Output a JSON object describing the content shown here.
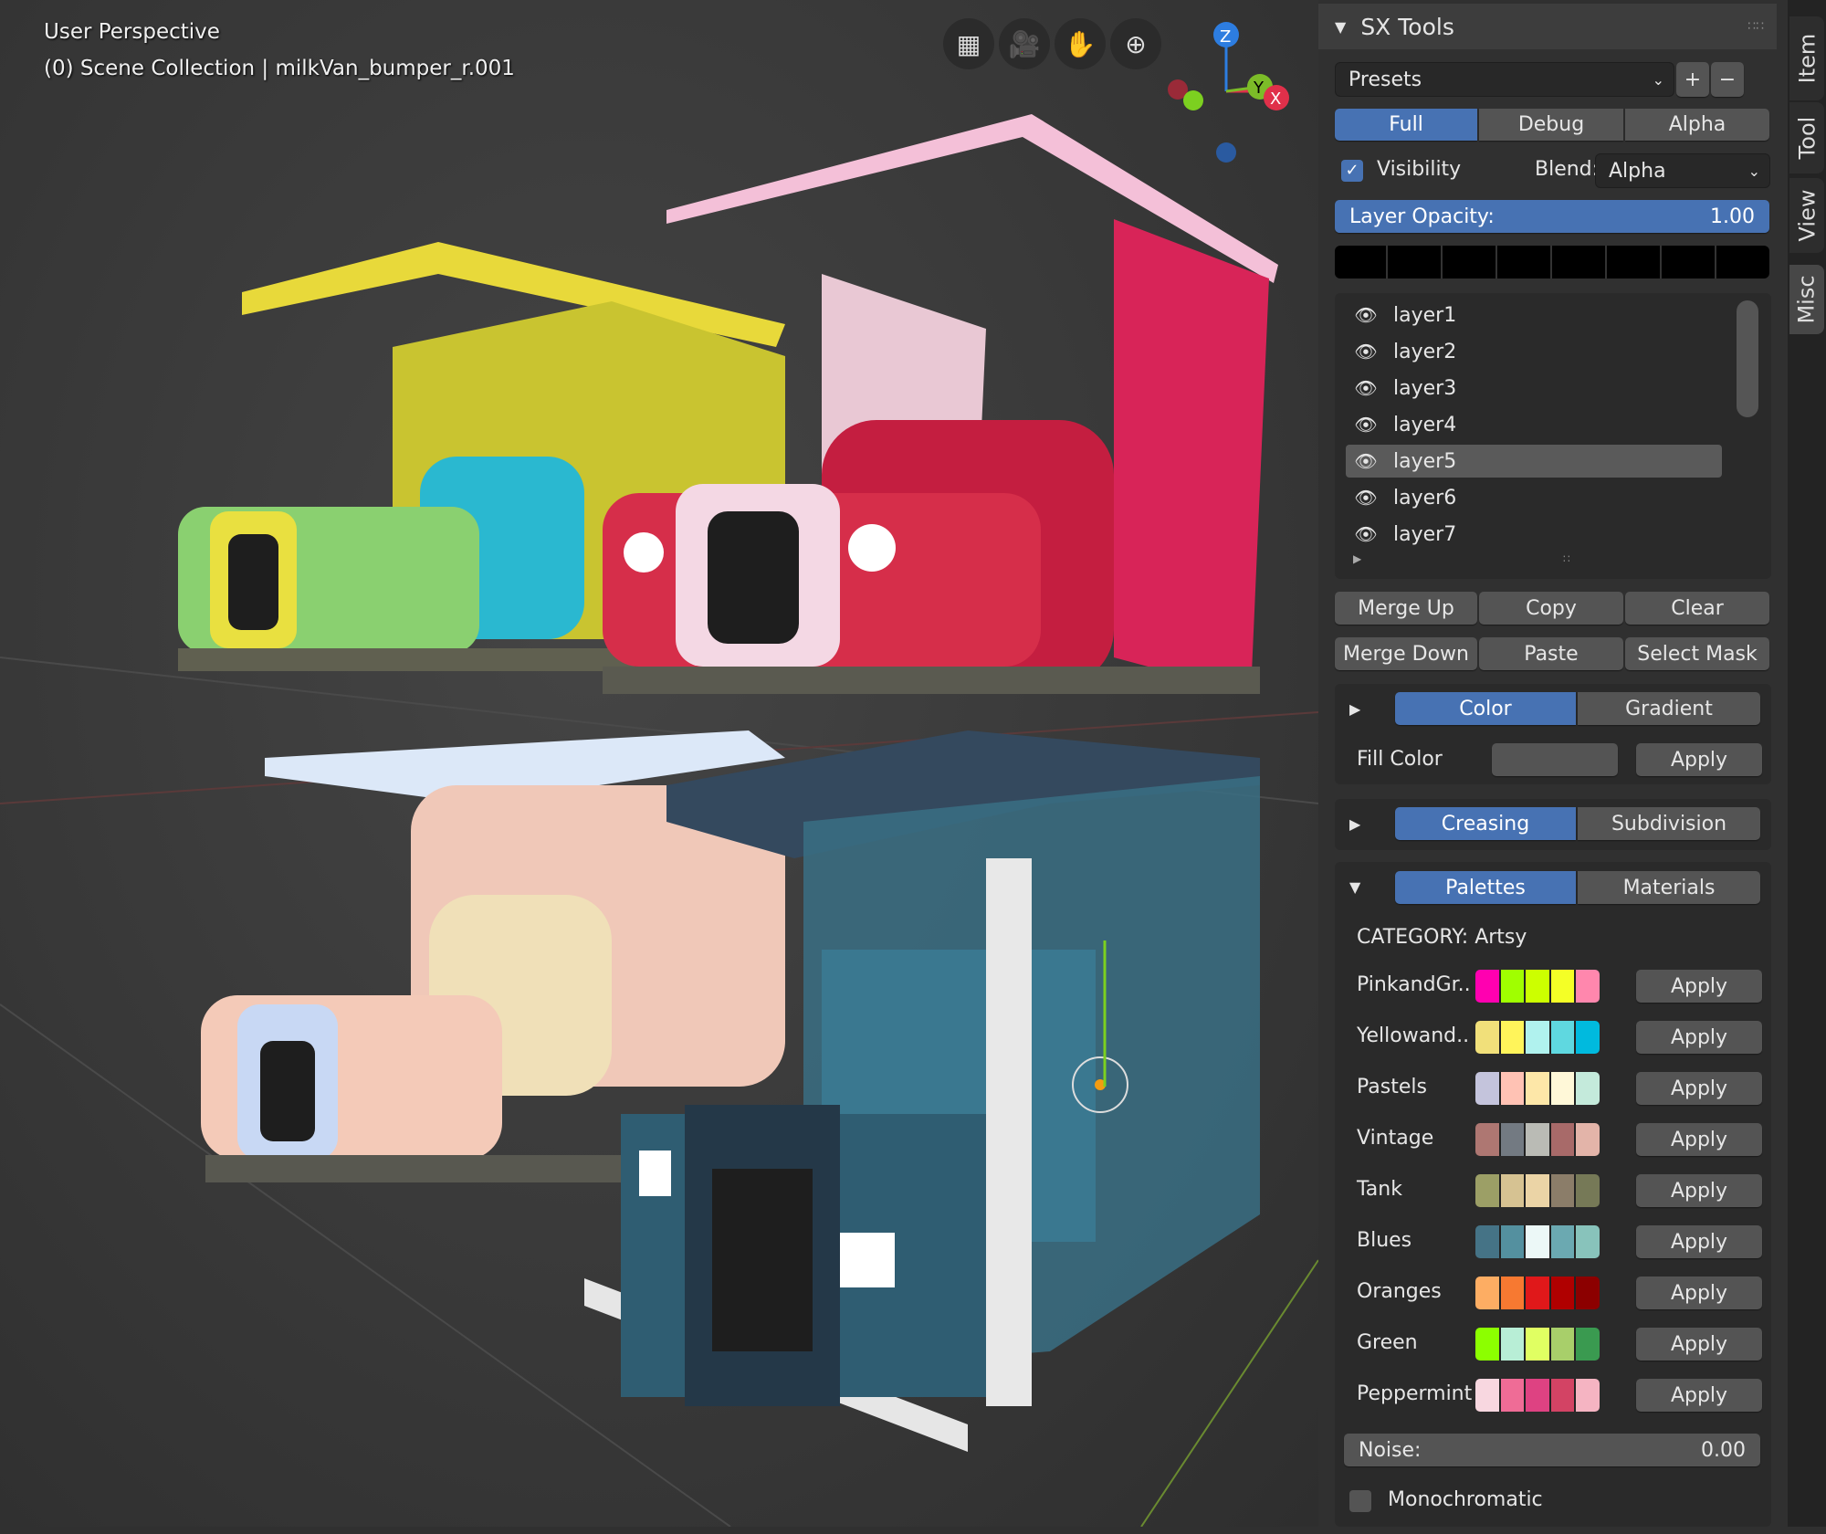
{
  "viewport": {
    "view_name": "User Perspective",
    "context": "(0) Scene Collection | milkVan_bumper_r.001",
    "nav_icons": [
      "grid-toggle-icon",
      "camera-icon",
      "hand-pan-icon",
      "zoom-icon"
    ],
    "gizmo": {
      "z": "Z",
      "y": "Y",
      "x": "X"
    }
  },
  "panel": {
    "title": "SX Tools",
    "presets_label": "Presets",
    "plus": "+",
    "minus": "−",
    "modes": [
      "Full",
      "Debug",
      "Alpha"
    ],
    "active_mode": "Full",
    "visibility_label": "Visibility",
    "visibility_checked": true,
    "blend_label": "Blend:",
    "blend_value": "Alpha",
    "opacity_label": "Layer Opacity:",
    "opacity_value": "1.00",
    "layers": [
      "layer1",
      "layer2",
      "layer3",
      "layer4",
      "layer5",
      "layer6",
      "layer7"
    ],
    "selected_layer": "layer5",
    "actions_row1": [
      "Merge Up",
      "Copy",
      "Clear"
    ],
    "actions_row2": [
      "Merge Down",
      "Paste",
      "Select Mask"
    ],
    "color_tabs": [
      "Color",
      "Gradient"
    ],
    "fill_color_label": "Fill Color",
    "apply": "Apply",
    "crease_tabs": [
      "Creasing",
      "Subdivision"
    ],
    "palette_tabs": [
      "Palettes",
      "Materials"
    ],
    "category": "CATEGORY: Artsy",
    "palettes": [
      {
        "name": "PinkandGr..",
        "colors": [
          "#ff00b0",
          "#a0ff00",
          "#ccff00",
          "#f4ff26",
          "#ff87ad"
        ]
      },
      {
        "name": "Yellowand..",
        "colors": [
          "#f1e07a",
          "#fff45a",
          "#b0f2ee",
          "#5fd8e0",
          "#00bade"
        ]
      },
      {
        "name": "Pastels",
        "colors": [
          "#c4c4dc",
          "#ffc2b4",
          "#fde7a8",
          "#fff8d8",
          "#c4eadb"
        ]
      },
      {
        "name": "Vintage",
        "colors": [
          "#ae7772",
          "#737a82",
          "#babbb5",
          "#a86a69",
          "#e3b4a9"
        ]
      },
      {
        "name": "Tank",
        "colors": [
          "#9c9f66",
          "#d6c292",
          "#ebd4a6",
          "#8b7d69",
          "#767957"
        ]
      },
      {
        "name": "Blues",
        "colors": [
          "#457386",
          "#54909f",
          "#ecf8f7",
          "#6ba9b1",
          "#88c3bb"
        ]
      },
      {
        "name": "Oranges",
        "colors": [
          "#fdad63",
          "#f77931",
          "#e0181a",
          "#b00000",
          "#8c0000"
        ]
      },
      {
        "name": "Green",
        "colors": [
          "#8cff00",
          "#b8eed6",
          "#e0ff62",
          "#a8cf6a",
          "#3a9a50"
        ]
      },
      {
        "name": "Peppermint",
        "colors": [
          "#f8d7e0",
          "#ef6c96",
          "#de4282",
          "#d34364",
          "#f5b4c2"
        ]
      }
    ],
    "noise_label": "Noise:",
    "noise_value": "0.00",
    "monochromatic_label": "Monochromatic"
  },
  "sidebar_tabs": [
    "Item",
    "Tool",
    "View",
    "Misc"
  ],
  "active_tab": "Misc"
}
